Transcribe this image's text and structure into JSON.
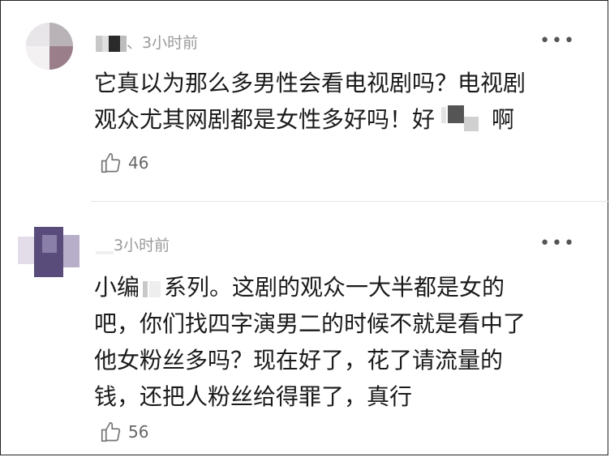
{
  "comments": [
    {
      "time": "3小时前",
      "text_line1": "它真以为那么多男性会看电视剧吗？电视剧",
      "text_line2": "观众尤其网剧都是女性多好吗！好",
      "text_line2_end": "啊",
      "likes": "46",
      "username_separator": "、"
    },
    {
      "time": "3小时前",
      "text_part1": "小编",
      "text_part2": "系列。这剧的观众一大半都是女的",
      "text_line2": "吧，你们找四字演男二的时候不就是看中了",
      "text_line3": "他女粉丝多吗？现在好了，花了请流量的",
      "text_line4": "钱，还把人粉丝给得罪了，真行",
      "likes": "56"
    }
  ],
  "icons": {
    "more": "more-dots-icon",
    "like": "thumbs-up-icon"
  }
}
